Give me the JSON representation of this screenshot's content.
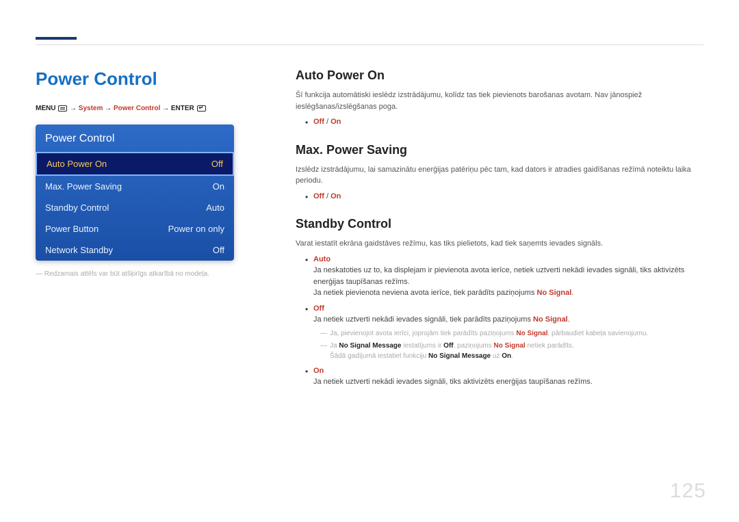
{
  "page_number": "125",
  "left": {
    "title": "Power Control",
    "breadcrumb": {
      "menu": "MENU",
      "arrow": " → ",
      "system": "System",
      "power_control": "Power Control",
      "enter": "ENTER"
    },
    "osd": {
      "title": "Power Control",
      "rows": [
        {
          "label": "Auto Power On",
          "value": "Off",
          "selected": true
        },
        {
          "label": "Max. Power Saving",
          "value": "On",
          "selected": false
        },
        {
          "label": "Standby Control",
          "value": "Auto",
          "selected": false
        },
        {
          "label": "Power Button",
          "value": "Power on only",
          "selected": false
        },
        {
          "label": "Network Standby",
          "value": "Off",
          "selected": false
        }
      ]
    },
    "caption": "Redzamais attēls var būt atšķirīgs atkarībā no modeļa."
  },
  "right": {
    "sections": [
      {
        "heading": "Auto Power On",
        "body": "Šī funkcija automātiski ieslēdz izstrādājumu, kolīdz tas tiek pievienots barošanas avotam. Nav jānospiež ieslēgšanas/izslēgšanas poga.",
        "options_html": "<span class=\"keyword\">Off</span> / <span class=\"keyword\">On</span>"
      },
      {
        "heading": "Max. Power Saving",
        "body": "Izslēdz izstrādājumu, lai samazinātu enerģijas patēriņu pēc tam, kad dators ir atradies gaidīšanas režīmā noteiktu laika periodu.",
        "options_html": "<span class=\"keyword\">Off</span> / <span class=\"keyword\">On</span>"
      },
      {
        "heading": "Standby Control",
        "body": "Varat iestatīt ekrāna gaidstāves režīmu, kas tiks pielietots, kad tiek saņemts ievades signāls.",
        "bullets": [
          {
            "label": "Auto",
            "text": "Ja neskatoties uz to, ka displejam ir pievienota avota ierīce, netiek uztverti nekādi ievades signāli, tiks aktivizēts enerģijas taupīšanas režīms.<br>Ja netiek pievienota neviena avota ierīce, tiek parādīts paziņojums <span class=\"keyword\">No Signal</span>."
          },
          {
            "label": "Off",
            "text": "Ja netiek uztverti nekādi ievades signāli, tiek parādīts paziņojums <span class=\"keyword\">No Signal</span>.",
            "sub": [
              "Ja, pievienojot avota ierīci, joprojām tiek parādīts paziņojums <span class=\"keyword\">No Signal</span>, pārbaudiet kabeļa savienojumu.",
              "Ja <span class=\"bold\">No Signal Message</span> iestatījums ir <span class=\"bold\">Off</span>, paziņojums <span class=\"keyword\">No Signal</span> netiek parādīts.<br>Šādā gadījumā iestatiet funkciju <span class=\"bold\">No Signal Message</span> uz <span class=\"bold\">On</span>."
            ]
          },
          {
            "label": "On",
            "text": "Ja netiek uztverti nekādi ievades signāli, tiks aktivizēts enerģijas taupīšanas režīms."
          }
        ]
      }
    ]
  }
}
